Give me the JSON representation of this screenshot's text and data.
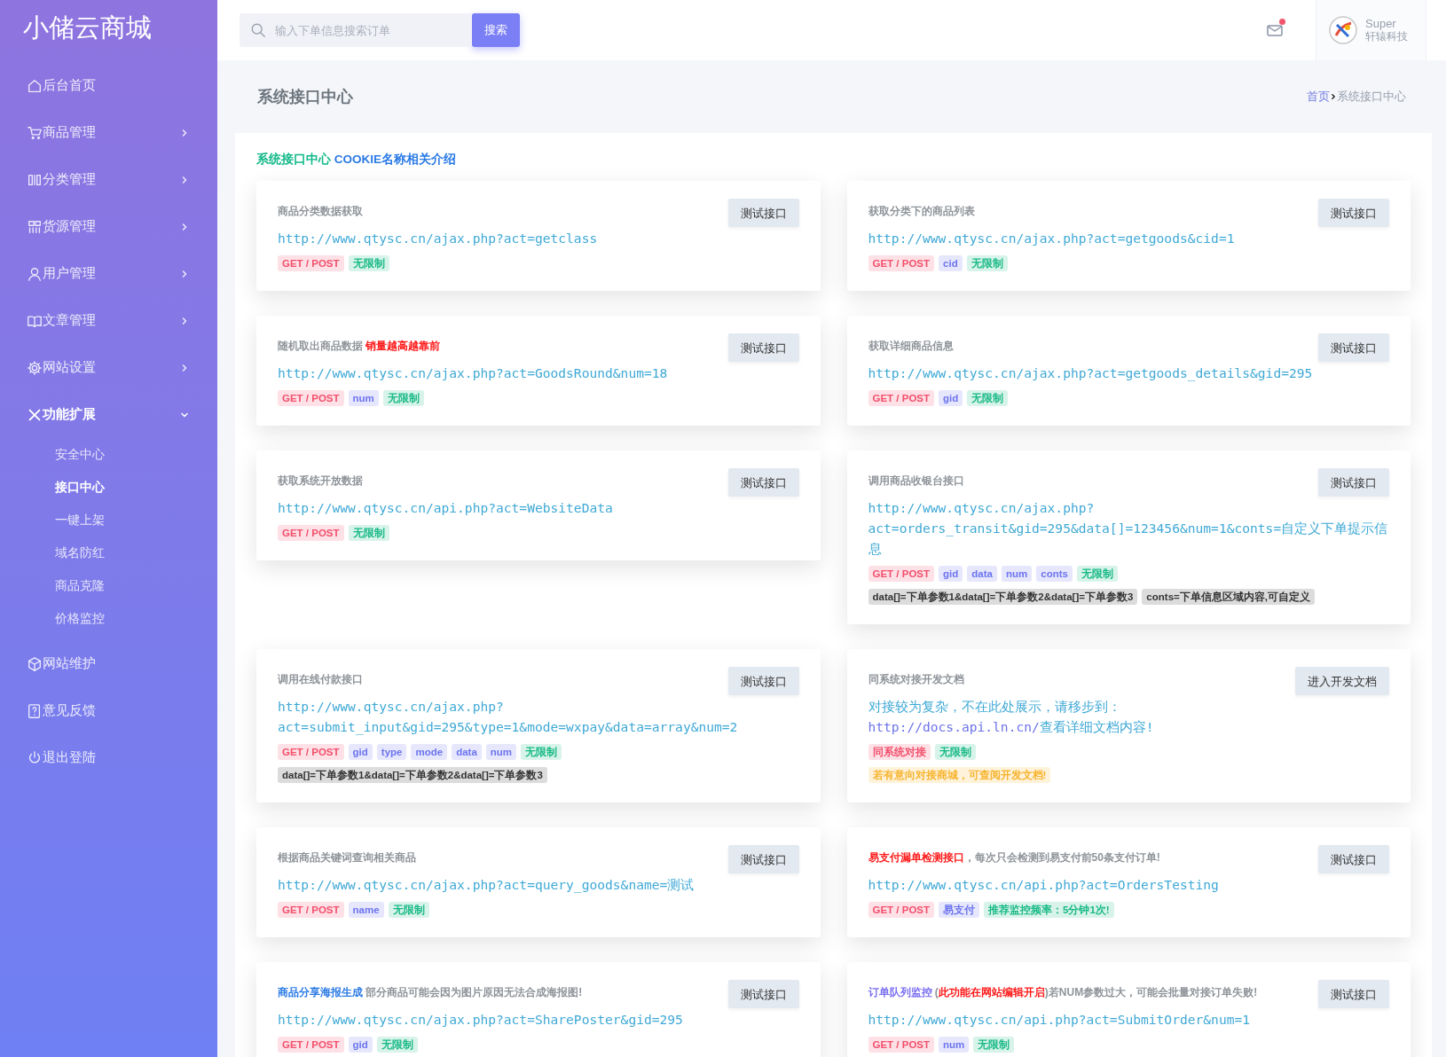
{
  "brand": "小储云商城",
  "sidebar": {
    "items": [
      {
        "label": "后台首页"
      },
      {
        "label": "商品管理",
        "expanded": false
      },
      {
        "label": "分类管理",
        "expanded": false
      },
      {
        "label": "货源管理",
        "expanded": false
      },
      {
        "label": "用户管理",
        "expanded": false
      },
      {
        "label": "文章管理",
        "expanded": false
      },
      {
        "label": "网站设置",
        "expanded": false
      },
      {
        "label": "功能扩展",
        "expanded": true,
        "children": [
          {
            "label": "安全中心",
            "selected": false
          },
          {
            "label": "接口中心",
            "selected": true
          },
          {
            "label": "一键上架",
            "selected": false
          },
          {
            "label": "域名防红",
            "selected": false
          },
          {
            "label": "商品克隆",
            "selected": false
          },
          {
            "label": "价格监控",
            "selected": false
          }
        ]
      },
      {
        "label": "网站维护"
      },
      {
        "label": "意见反馈"
      },
      {
        "label": "退出登陆"
      }
    ]
  },
  "header": {
    "search": {
      "placeholder": "输入下单信息搜索订单",
      "button": "搜索"
    },
    "mail_unread": true,
    "user": {
      "name": "Super",
      "company": "轩辕科技"
    }
  },
  "page": {
    "title": "系统接口中心",
    "breadcrumb": [
      {
        "label": "首页",
        "selected": false
      },
      {
        "label": "系统接口中心",
        "selected": true
      }
    ]
  },
  "panel": {
    "heading": [
      {
        "text": "系统接口中心",
        "color": "#13b98a"
      },
      {
        "text": " COOKIE名称相关介绍",
        "color": "#2c7be5"
      }
    ],
    "cards": [
      {
        "title": [
          {
            "text": "商品分类数据获取",
            "color": "#8f949a"
          }
        ],
        "url": [
          [
            {
              "text": "http://www.qtysc.cn/ajax.php?act=getclass",
              "color": "#3fa9d6"
            }
          ]
        ],
        "tags": [
          {
            "text": "GET / POST",
            "color": "#f3506c"
          },
          {
            "text": "无限制",
            "color": "#18b985"
          }
        ],
        "button": "测试接口"
      },
      {
        "title": [
          {
            "text": "获取分类下的商品列表",
            "color": "#8f949a"
          }
        ],
        "url": [
          [
            {
              "text": "http://www.qtysc.cn/ajax.php?act=getgoods&cid=1",
              "color": "#3fa9d6"
            }
          ]
        ],
        "tags": [
          {
            "text": "GET / POST",
            "color": "#f3506c"
          },
          {
            "text": "cid",
            "color": "#6c74ee"
          },
          {
            "text": "无限制",
            "color": "#18b985"
          }
        ],
        "button": "测试接口"
      },
      {
        "title": [
          {
            "text": "随机取出商品数据 ",
            "color": "#8f949a"
          },
          {
            "text": "销量越高越靠前",
            "color": "#ff1a1a"
          }
        ],
        "url": [
          [
            {
              "text": "http://www.qtysc.cn/ajax.php?act=GoodsRound&num=18",
              "color": "#3fa9d6"
            }
          ]
        ],
        "tags": [
          {
            "text": "GET / POST",
            "color": "#f3506c"
          },
          {
            "text": "num",
            "color": "#6c74ee"
          },
          {
            "text": "无限制",
            "color": "#18b985"
          }
        ],
        "button": "测试接口"
      },
      {
        "title": [
          {
            "text": "获取详细商品信息",
            "color": "#8f949a"
          }
        ],
        "url": [
          [
            {
              "text": "http://www.qtysc.cn/ajax.php?act=getgoods_details&gid=295",
              "color": "#3fa9d6"
            }
          ]
        ],
        "tags": [
          {
            "text": "GET / POST",
            "color": "#f3506c"
          },
          {
            "text": "gid",
            "color": "#6c74ee"
          },
          {
            "text": "无限制",
            "color": "#18b985"
          }
        ],
        "button": "测试接口"
      },
      {
        "title": [
          {
            "text": "获取系统开放数据",
            "color": "#8f949a"
          }
        ],
        "url": [
          [
            {
              "text": "http://www.qtysc.cn/api.php?act=WebsiteData",
              "color": "#3fa9d6"
            }
          ]
        ],
        "tags": [
          {
            "text": "GET / POST",
            "color": "#f3506c"
          },
          {
            "text": "无限制",
            "color": "#18b985"
          }
        ],
        "button": "测试接口"
      },
      {
        "title": [
          {
            "text": "调用商品收银台接口",
            "color": "#8f949a"
          }
        ],
        "url": [
          [
            {
              "text": "http://www.qtysc.cn/ajax.php?",
              "color": "#3fa9d6"
            }
          ],
          [
            {
              "text": "act=orders_transit&gid=295&data[]=123456&num=1&conts=自定义下单提示信息",
              "color": "#3fa9d6"
            }
          ]
        ],
        "tags": [
          {
            "text": "GET / POST",
            "color": "#f3506c"
          },
          {
            "text": "gid",
            "color": "#6c74ee"
          },
          {
            "text": "data",
            "color": "#6c74ee"
          },
          {
            "text": "num",
            "color": "#6c74ee"
          },
          {
            "text": "conts",
            "color": "#6c74ee"
          },
          {
            "text": "无限制",
            "color": "#18b985"
          }
        ],
        "notes": [
          {
            "text": "data[]=下单参数1&data[]=下单参数2&data[]=下单参数3",
            "color": "#333333"
          },
          {
            "text": "conts=下单信息区域内容,可自定义",
            "color": "#333333"
          }
        ],
        "button": "测试接口"
      },
      {
        "title": [
          {
            "text": "调用在线付款接口",
            "color": "#8f949a"
          }
        ],
        "url": [
          [
            {
              "text": "http://www.qtysc.cn/ajax.php?",
              "color": "#3fa9d6"
            }
          ],
          [
            {
              "text": "act=submit_input&gid=295&type=1&mode=wxpay&data=array&num=2",
              "color": "#3fa9d6"
            }
          ]
        ],
        "tags": [
          {
            "text": "GET / POST",
            "color": "#f3506c"
          },
          {
            "text": "gid",
            "color": "#6c74ee"
          },
          {
            "text": "type",
            "color": "#6c74ee"
          },
          {
            "text": "mode",
            "color": "#6c74ee"
          },
          {
            "text": "data",
            "color": "#6c74ee"
          },
          {
            "text": "num",
            "color": "#6c74ee"
          },
          {
            "text": "无限制",
            "color": "#18b985"
          }
        ],
        "notes": [
          {
            "text": "data[]=下单参数1&data[]=下单参数2&data[]=下单参数3",
            "color": "#333333"
          }
        ],
        "button": "测试接口"
      },
      {
        "title": [
          {
            "text": "同系统对接开发文档",
            "color": "#8f949a"
          }
        ],
        "url": [
          [
            {
              "text": "对接较为复杂，不在此处展示，请移步到：",
              "color": "#3fa9d6"
            }
          ],
          [
            {
              "text": "http://docs.api.ln.cn/",
              "color": "#6d74e8"
            },
            {
              "text": "查看详细文档内容!",
              "color": "#3fa9d6"
            }
          ]
        ],
        "tags": [
          {
            "text": "同系统对接",
            "color": "#f3506c"
          },
          {
            "text": "无限制",
            "color": "#18b985"
          }
        ],
        "notes": [
          {
            "text": "若有意向对接商城，可查阅开发文档!",
            "color": "#f7b32b"
          }
        ],
        "button": "进入开发文档"
      },
      {
        "title": [
          {
            "text": "根据商品关键词查询相关商品",
            "color": "#8f949a"
          }
        ],
        "url": [
          [
            {
              "text": "http://www.qtysc.cn/ajax.php?act=query_goods&name=测试",
              "color": "#3fa9d6"
            }
          ]
        ],
        "tags": [
          {
            "text": "GET / POST",
            "color": "#f3506c"
          },
          {
            "text": "name",
            "color": "#6c74ee"
          },
          {
            "text": "无限制",
            "color": "#18b985"
          }
        ],
        "button": "测试接口"
      },
      {
        "title": [
          {
            "text": "易支付漏单检测接口",
            "color": "#ff1a1a"
          },
          {
            "text": "，每次只会检测到易支付前50条支付订单!",
            "color": "#8f949a"
          }
        ],
        "url": [
          [
            {
              "text": "http://www.qtysc.cn/api.php?act=OrdersTesting",
              "color": "#3fa9d6"
            }
          ]
        ],
        "tags": [
          {
            "text": "GET / POST",
            "color": "#f3506c"
          },
          {
            "text": "易支付",
            "color": "#6c74ee"
          },
          {
            "text": "推荐监控频率：5分钟1次!",
            "color": "#18b985"
          }
        ],
        "button": "测试接口"
      },
      {
        "title": [
          {
            "text": "商品分享海报生成",
            "color": "#2c7be5"
          },
          {
            "text": " 部分商品可能会因为图片原因无法合成海报图!",
            "color": "#8f949a"
          }
        ],
        "url": [
          [
            {
              "text": "http://www.qtysc.cn/ajax.php?act=SharePoster&gid=295",
              "color": "#3fa9d6"
            }
          ]
        ],
        "tags": [
          {
            "text": "GET / POST",
            "color": "#f3506c"
          },
          {
            "text": "gid",
            "color": "#6c74ee"
          },
          {
            "text": "无限制",
            "color": "#18b985"
          }
        ],
        "button": "测试接口"
      },
      {
        "title": [
          {
            "text": "订单队列监控",
            "color": "#7a6ff0"
          },
          {
            "text": " (",
            "color": "#8f949a"
          },
          {
            "text": "此功能在网站编辑开启",
            "color": "#ff1a1a"
          },
          {
            "text": ")若NUM参数过大，可能会批量对接订单失败!",
            "color": "#8f949a"
          }
        ],
        "url": [
          [
            {
              "text": "http://www.qtysc.cn/api.php?act=SubmitOrder&num=1",
              "color": "#3fa9d6"
            }
          ]
        ],
        "tags": [
          {
            "text": "GET / POST",
            "color": "#f3506c"
          },
          {
            "text": "num",
            "color": "#6c74ee"
          },
          {
            "text": "无限制",
            "color": "#18b985"
          }
        ],
        "button": "测试接口"
      }
    ]
  }
}
